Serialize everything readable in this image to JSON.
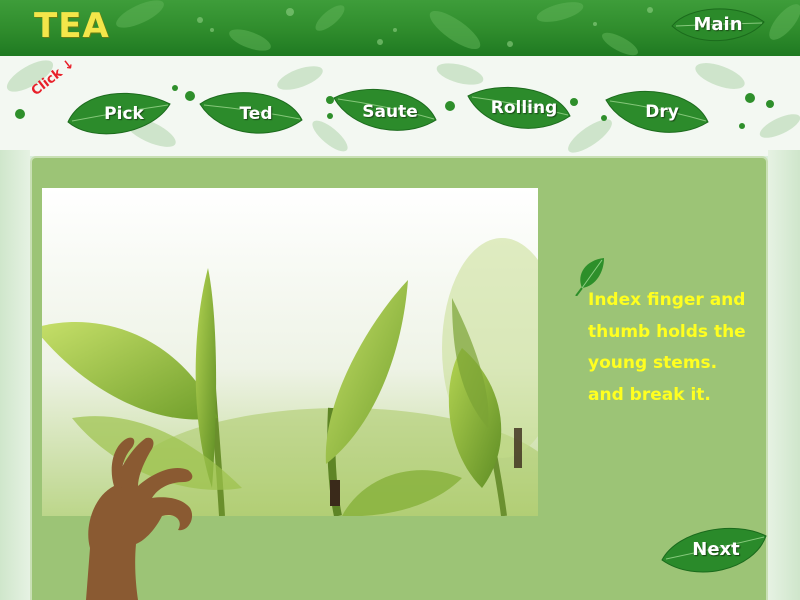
{
  "header": {
    "title": "TEA",
    "main_button": "Main"
  },
  "nav": {
    "hint": "Click ↓",
    "tabs": [
      {
        "label": "Pick"
      },
      {
        "label": "Ted"
      },
      {
        "label": "Saute"
      },
      {
        "label": "Rolling"
      },
      {
        "label": "Dry"
      }
    ]
  },
  "content": {
    "instruction_lines": [
      "Index finger and",
      "thumb holds the",
      "young stems.",
      "and break it."
    ],
    "next_button": "Next"
  },
  "colors": {
    "header_green": "#2f8c2c",
    "title_yellow": "#f4e64a",
    "leaf_green": "#2a8a2a",
    "panel_green": "#9cc476",
    "instruction_yellow": "#ffff20",
    "hint_red": "#e8202a",
    "hand_brown": "#8a5a32"
  },
  "icons": {
    "main": "leaf-icon",
    "tabs": "leaf-icon",
    "bullet": "leaf-icon",
    "next": "leaf-icon",
    "hand": "hand-icon"
  }
}
